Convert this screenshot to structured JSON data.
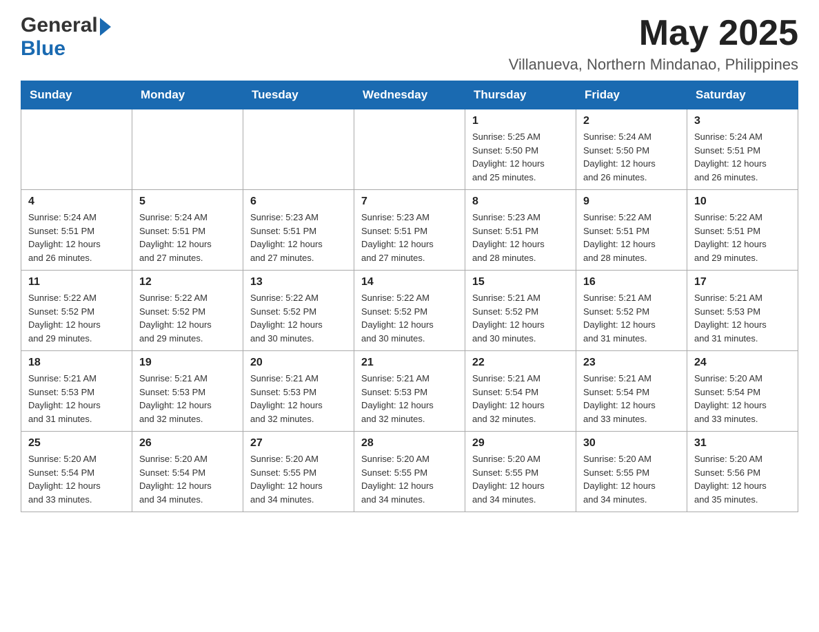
{
  "header": {
    "logo_general": "General",
    "logo_blue": "Blue",
    "month_year": "May 2025",
    "location": "Villanueva, Northern Mindanao, Philippines"
  },
  "days_of_week": [
    "Sunday",
    "Monday",
    "Tuesday",
    "Wednesday",
    "Thursday",
    "Friday",
    "Saturday"
  ],
  "weeks": [
    [
      {
        "day": "",
        "info": ""
      },
      {
        "day": "",
        "info": ""
      },
      {
        "day": "",
        "info": ""
      },
      {
        "day": "",
        "info": ""
      },
      {
        "day": "1",
        "info": "Sunrise: 5:25 AM\nSunset: 5:50 PM\nDaylight: 12 hours\nand 25 minutes."
      },
      {
        "day": "2",
        "info": "Sunrise: 5:24 AM\nSunset: 5:50 PM\nDaylight: 12 hours\nand 26 minutes."
      },
      {
        "day": "3",
        "info": "Sunrise: 5:24 AM\nSunset: 5:51 PM\nDaylight: 12 hours\nand 26 minutes."
      }
    ],
    [
      {
        "day": "4",
        "info": "Sunrise: 5:24 AM\nSunset: 5:51 PM\nDaylight: 12 hours\nand 26 minutes."
      },
      {
        "day": "5",
        "info": "Sunrise: 5:24 AM\nSunset: 5:51 PM\nDaylight: 12 hours\nand 27 minutes."
      },
      {
        "day": "6",
        "info": "Sunrise: 5:23 AM\nSunset: 5:51 PM\nDaylight: 12 hours\nand 27 minutes."
      },
      {
        "day": "7",
        "info": "Sunrise: 5:23 AM\nSunset: 5:51 PM\nDaylight: 12 hours\nand 27 minutes."
      },
      {
        "day": "8",
        "info": "Sunrise: 5:23 AM\nSunset: 5:51 PM\nDaylight: 12 hours\nand 28 minutes."
      },
      {
        "day": "9",
        "info": "Sunrise: 5:22 AM\nSunset: 5:51 PM\nDaylight: 12 hours\nand 28 minutes."
      },
      {
        "day": "10",
        "info": "Sunrise: 5:22 AM\nSunset: 5:51 PM\nDaylight: 12 hours\nand 29 minutes."
      }
    ],
    [
      {
        "day": "11",
        "info": "Sunrise: 5:22 AM\nSunset: 5:52 PM\nDaylight: 12 hours\nand 29 minutes."
      },
      {
        "day": "12",
        "info": "Sunrise: 5:22 AM\nSunset: 5:52 PM\nDaylight: 12 hours\nand 29 minutes."
      },
      {
        "day": "13",
        "info": "Sunrise: 5:22 AM\nSunset: 5:52 PM\nDaylight: 12 hours\nand 30 minutes."
      },
      {
        "day": "14",
        "info": "Sunrise: 5:22 AM\nSunset: 5:52 PM\nDaylight: 12 hours\nand 30 minutes."
      },
      {
        "day": "15",
        "info": "Sunrise: 5:21 AM\nSunset: 5:52 PM\nDaylight: 12 hours\nand 30 minutes."
      },
      {
        "day": "16",
        "info": "Sunrise: 5:21 AM\nSunset: 5:52 PM\nDaylight: 12 hours\nand 31 minutes."
      },
      {
        "day": "17",
        "info": "Sunrise: 5:21 AM\nSunset: 5:53 PM\nDaylight: 12 hours\nand 31 minutes."
      }
    ],
    [
      {
        "day": "18",
        "info": "Sunrise: 5:21 AM\nSunset: 5:53 PM\nDaylight: 12 hours\nand 31 minutes."
      },
      {
        "day": "19",
        "info": "Sunrise: 5:21 AM\nSunset: 5:53 PM\nDaylight: 12 hours\nand 32 minutes."
      },
      {
        "day": "20",
        "info": "Sunrise: 5:21 AM\nSunset: 5:53 PM\nDaylight: 12 hours\nand 32 minutes."
      },
      {
        "day": "21",
        "info": "Sunrise: 5:21 AM\nSunset: 5:53 PM\nDaylight: 12 hours\nand 32 minutes."
      },
      {
        "day": "22",
        "info": "Sunrise: 5:21 AM\nSunset: 5:54 PM\nDaylight: 12 hours\nand 32 minutes."
      },
      {
        "day": "23",
        "info": "Sunrise: 5:21 AM\nSunset: 5:54 PM\nDaylight: 12 hours\nand 33 minutes."
      },
      {
        "day": "24",
        "info": "Sunrise: 5:20 AM\nSunset: 5:54 PM\nDaylight: 12 hours\nand 33 minutes."
      }
    ],
    [
      {
        "day": "25",
        "info": "Sunrise: 5:20 AM\nSunset: 5:54 PM\nDaylight: 12 hours\nand 33 minutes."
      },
      {
        "day": "26",
        "info": "Sunrise: 5:20 AM\nSunset: 5:54 PM\nDaylight: 12 hours\nand 34 minutes."
      },
      {
        "day": "27",
        "info": "Sunrise: 5:20 AM\nSunset: 5:55 PM\nDaylight: 12 hours\nand 34 minutes."
      },
      {
        "day": "28",
        "info": "Sunrise: 5:20 AM\nSunset: 5:55 PM\nDaylight: 12 hours\nand 34 minutes."
      },
      {
        "day": "29",
        "info": "Sunrise: 5:20 AM\nSunset: 5:55 PM\nDaylight: 12 hours\nand 34 minutes."
      },
      {
        "day": "30",
        "info": "Sunrise: 5:20 AM\nSunset: 5:55 PM\nDaylight: 12 hours\nand 34 minutes."
      },
      {
        "day": "31",
        "info": "Sunrise: 5:20 AM\nSunset: 5:56 PM\nDaylight: 12 hours\nand 35 minutes."
      }
    ]
  ]
}
